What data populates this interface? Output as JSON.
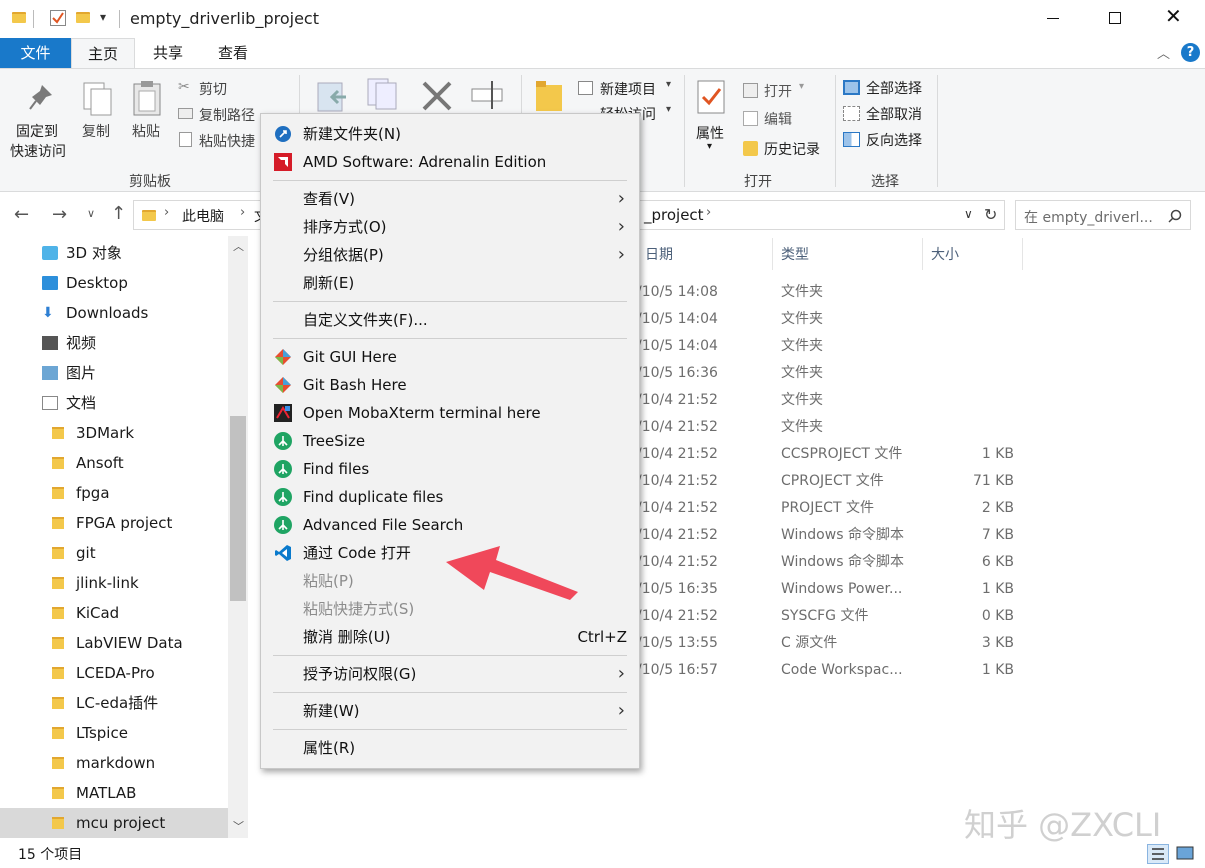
{
  "window": {
    "title": "empty_driverlib_project",
    "minimize_icon": "minimize-icon",
    "maximize_icon": "maximize-icon",
    "close_icon": "close-icon"
  },
  "ribbon_tabs": [
    "文件",
    "主页",
    "共享",
    "查看"
  ],
  "ribbon": {
    "pin": "固定到\n快速访问",
    "pin_line1": "固定到",
    "pin_line2": "快速访问",
    "copy": "复制",
    "paste": "粘贴",
    "cut": "剪切",
    "copy_path": "复制路径",
    "paste_shortcut": "粘贴快捷",
    "clipboard_group": "剪贴板",
    "new_item": "新建项目",
    "easy_access": "轻松访问",
    "properties": "属性",
    "open": "打开",
    "edit": "编辑",
    "history": "历史记录",
    "open_group": "打开",
    "select_all": "全部选择",
    "select_none": "全部取消",
    "invert": "反向选择",
    "select_group": "选择"
  },
  "address": {
    "crumb_pc": "此电脑",
    "crumb_partial": "文",
    "crumb_tail": "_project",
    "search_placeholder": "在 empty_driverl..."
  },
  "nav_items": [
    {
      "label": "3D 对象",
      "icon": "3d-objects-icon"
    },
    {
      "label": "Desktop",
      "icon": "desktop-icon"
    },
    {
      "label": "Downloads",
      "icon": "download-icon"
    },
    {
      "label": "视频",
      "icon": "video-icon"
    },
    {
      "label": "图片",
      "icon": "picture-icon"
    },
    {
      "label": "文档",
      "icon": "document-icon"
    },
    {
      "label": "3DMark",
      "icon": "folder-icon"
    },
    {
      "label": "Ansoft",
      "icon": "folder-icon"
    },
    {
      "label": "fpga",
      "icon": "folder-icon"
    },
    {
      "label": "FPGA project",
      "icon": "folder-icon"
    },
    {
      "label": "git",
      "icon": "folder-icon"
    },
    {
      "label": "jlink-link",
      "icon": "folder-icon"
    },
    {
      "label": "KiCad",
      "icon": "folder-icon"
    },
    {
      "label": "LabVIEW Data",
      "icon": "folder-icon"
    },
    {
      "label": "LCEDA-Pro",
      "icon": "folder-icon"
    },
    {
      "label": "LC-eda插件",
      "icon": "folder-icon"
    },
    {
      "label": "LTspice",
      "icon": "folder-icon"
    },
    {
      "label": "markdown",
      "icon": "folder-icon"
    },
    {
      "label": "MATLAB",
      "icon": "folder-icon"
    },
    {
      "label": "mcu project",
      "icon": "folder-icon"
    }
  ],
  "columns": {
    "date": "日期",
    "type": "类型",
    "size": "大小"
  },
  "files": [
    {
      "date": "/10/5 14:08",
      "type": "文件夹",
      "size": ""
    },
    {
      "date": "/10/5 14:04",
      "type": "文件夹",
      "size": ""
    },
    {
      "date": "/10/5 14:04",
      "type": "文件夹",
      "size": ""
    },
    {
      "date": "/10/5 16:36",
      "type": "文件夹",
      "size": ""
    },
    {
      "date": "/10/4 21:52",
      "type": "文件夹",
      "size": ""
    },
    {
      "date": "/10/4 21:52",
      "type": "文件夹",
      "size": ""
    },
    {
      "date": "/10/4 21:52",
      "type": "CCSPROJECT 文件",
      "size": "1 KB"
    },
    {
      "date": "/10/4 21:52",
      "type": "CPROJECT 文件",
      "size": "71 KB"
    },
    {
      "date": "/10/4 21:52",
      "type": "PROJECT 文件",
      "size": "2 KB"
    },
    {
      "date": "/10/4 21:52",
      "type": "Windows 命令脚本",
      "size": "7 KB"
    },
    {
      "date": "/10/4 21:52",
      "type": "Windows 命令脚本",
      "size": "6 KB"
    },
    {
      "date": "/10/5 16:35",
      "type": "Windows Power...",
      "size": "1 KB"
    },
    {
      "date": "/10/4 21:52",
      "type": "SYSCFG 文件",
      "size": "0 KB"
    },
    {
      "date": "/10/5 13:55",
      "type": "C 源文件",
      "size": "3 KB"
    },
    {
      "date": "/10/5 16:57",
      "type": "Code Workspac...",
      "size": "1 KB"
    }
  ],
  "context_menu": {
    "new_folder": "新建文件夹(N)",
    "amd": "AMD Software: Adrenalin Edition",
    "view": "查看(V)",
    "sort": "排序方式(O)",
    "group": "分组依据(P)",
    "refresh": "刷新(E)",
    "customize": "自定义文件夹(F)...",
    "git_gui": "Git GUI Here",
    "git_bash": "Git Bash Here",
    "moba": "Open MobaXterm terminal here",
    "treesize": "TreeSize",
    "find_files": "Find files",
    "find_dup": "Find duplicate files",
    "adv_search": "Advanced File Search",
    "open_code": "通过 Code 打开",
    "paste": "粘贴(P)",
    "paste_shortcut": "粘贴快捷方式(S)",
    "undo": "撤消 删除(U)",
    "undo_shortcut": "Ctrl+Z",
    "grant": "授予访问权限(G)",
    "new": "新建(W)",
    "properties": "属性(R)"
  },
  "status": {
    "count": "15 个项目"
  },
  "watermark": "知乎 @ZXCLI",
  "colors": {
    "accent": "#1979ca",
    "arrow": "#f0485a"
  }
}
